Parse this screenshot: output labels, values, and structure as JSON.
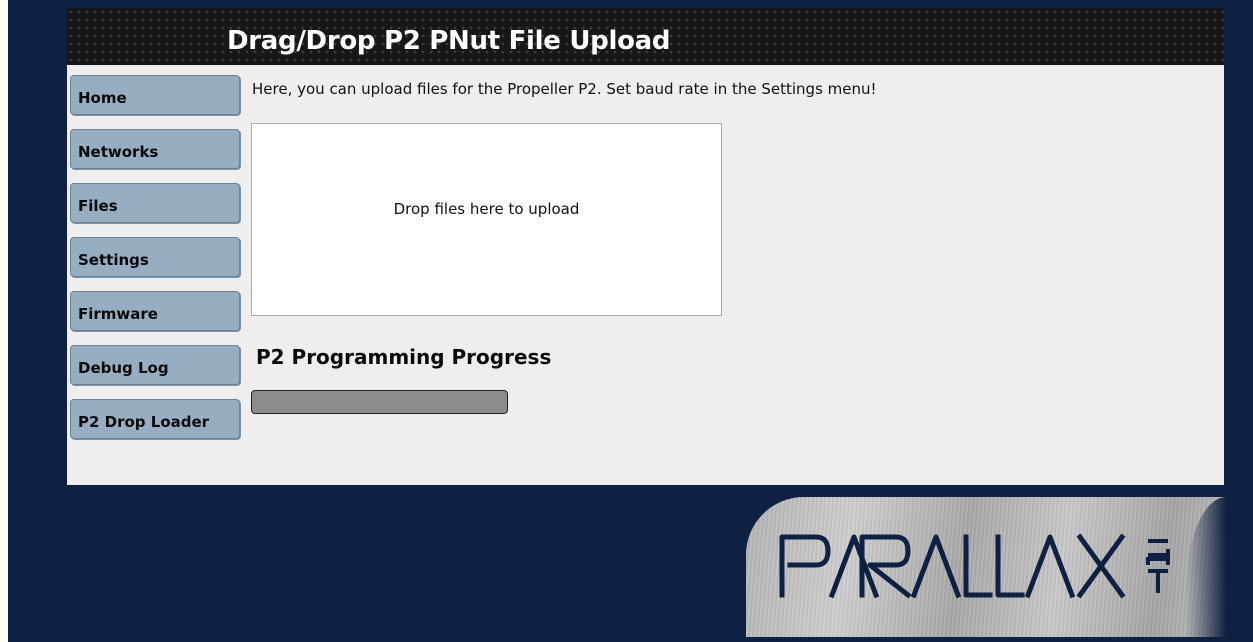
{
  "header": {
    "title": "Drag/Drop P2 PNut File Upload"
  },
  "sidebar": {
    "items": [
      {
        "label": "Home"
      },
      {
        "label": "Networks"
      },
      {
        "label": "Files"
      },
      {
        "label": "Settings"
      },
      {
        "label": "Firmware"
      },
      {
        "label": "Debug Log"
      },
      {
        "label": "P2 Drop Loader"
      }
    ]
  },
  "main": {
    "intro_text": "Here, you can upload files for the Propeller P2. Set baud rate in the Settings menu!",
    "dropzone_text": "Drop files here to upload",
    "progress_heading": "P2 Programming Progress",
    "progress_value": 0
  },
  "logo": {
    "text": "PARALLAX INC"
  },
  "colors": {
    "page_background": "#0f2143",
    "content_background": "#eeeeee",
    "nav_button": "#97adc2",
    "progress_track": "#8c8c8c"
  }
}
